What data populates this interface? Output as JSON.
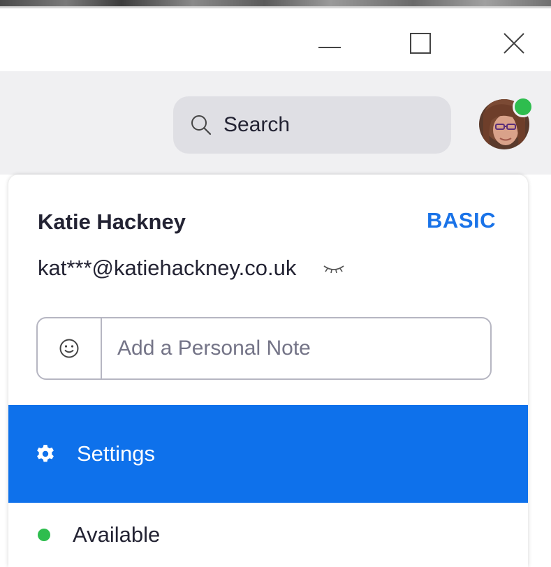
{
  "window": {
    "minimize_icon": "minimize-icon",
    "maximize_icon": "maximize-icon",
    "close_icon": "close-icon"
  },
  "header": {
    "search_label": "Search",
    "search_icon": "search-icon",
    "avatar_status": "online",
    "status_color": "#2ebd4e"
  },
  "profile": {
    "name": "Katie Hackney",
    "plan": "BASIC",
    "email": "kat***@katiehackney.co.uk",
    "email_toggle_icon": "eye-closed-icon",
    "note_placeholder": "Add a Personal Note",
    "note_value": "",
    "note_emoji_icon": "smiley-icon"
  },
  "menu": {
    "items": [
      {
        "label": "Settings",
        "icon": "gear-icon",
        "selected": true
      },
      {
        "label": "Available",
        "icon": "status-dot",
        "color": "#2ebd4e"
      }
    ]
  },
  "colors": {
    "accent": "#0e71eb",
    "plan_text": "#1a73e8",
    "header_bg": "#f0f0f2",
    "search_bg": "#dfdfe4"
  }
}
